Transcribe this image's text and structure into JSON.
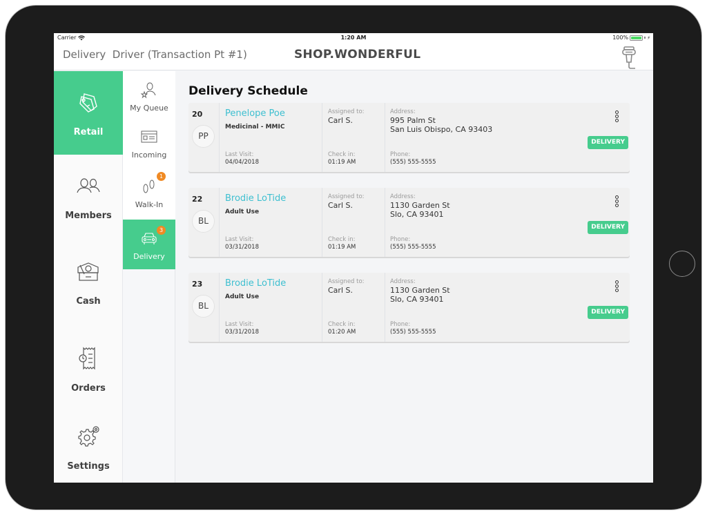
{
  "status_bar": {
    "carrier": "Carrier",
    "time": "1:20 AM",
    "battery": "100%",
    "battery_level": 1.0
  },
  "header": {
    "role": "Delivery  Driver (Transaction Pt #1)",
    "brand": "SHOP.WONDERFUL",
    "scanner_icon": "barcode-scanner-icon"
  },
  "colors": {
    "accent": "#46cc8d",
    "link": "#3dbfd0",
    "badge": "#f08a24"
  },
  "nav_primary": [
    {
      "label": "Retail",
      "icon": "price-tags-icon",
      "active": true
    },
    {
      "label": "Members",
      "icon": "members-icon",
      "active": false
    },
    {
      "label": "Cash",
      "icon": "cash-drawer-icon",
      "active": false
    },
    {
      "label": "Orders",
      "icon": "receipt-clock-icon",
      "active": false
    },
    {
      "label": "Settings",
      "icon": "gears-icon",
      "active": false
    }
  ],
  "nav_secondary": [
    {
      "label": "My Queue",
      "icon": "user-star-icon",
      "badge": null,
      "active": false
    },
    {
      "label": "Incoming",
      "icon": "browser-window-icon",
      "badge": null,
      "active": false
    },
    {
      "label": "Walk-In",
      "icon": "footprints-icon",
      "badge": "1",
      "active": false
    },
    {
      "label": "Delivery",
      "icon": "car-icon",
      "badge": "3",
      "active": true
    }
  ],
  "main": {
    "title": "Delivery Schedule",
    "cards": [
      {
        "number": "20",
        "initials": "PP",
        "name": "Penelope Poe",
        "type": "Medicinal - MMIC",
        "last_visit_label": "Last Visit:",
        "last_visit": "04/04/2018",
        "assigned_label": "Assigned to:",
        "assigned": "Carl S.",
        "checkin_label": "Check in:",
        "checkin": "01:19 AM",
        "address_label": "Address:",
        "address_line1": "995 Palm St",
        "address_line2": "San Luis Obispo, CA 93403",
        "phone_label": "Phone:",
        "phone": "(555) 555-5555",
        "action": "DELIVERY"
      },
      {
        "number": "22",
        "initials": "BL",
        "name": "Brodie LoTide",
        "type": "Adult Use",
        "last_visit_label": "Last Visit:",
        "last_visit": "03/31/2018",
        "assigned_label": "Assigned to:",
        "assigned": "Carl S.",
        "checkin_label": "Check in:",
        "checkin": "01:19 AM",
        "address_label": "Address:",
        "address_line1": "1130 Garden St",
        "address_line2": "Slo, CA 93401",
        "phone_label": "Phone:",
        "phone": "(555) 555-5555",
        "action": "DELIVERY"
      },
      {
        "number": "23",
        "initials": "BL",
        "name": "Brodie LoTide",
        "type": "Adult Use",
        "last_visit_label": "Last Visit:",
        "last_visit": "03/31/2018",
        "assigned_label": "Assigned to:",
        "assigned": "Carl S.",
        "checkin_label": "Check in:",
        "checkin": "01:20 AM",
        "address_label": "Address:",
        "address_line1": "1130 Garden St",
        "address_line2": "Slo, CA 93401",
        "phone_label": "Phone:",
        "phone": "(555) 555-5555",
        "action": "DELIVERY"
      }
    ]
  }
}
